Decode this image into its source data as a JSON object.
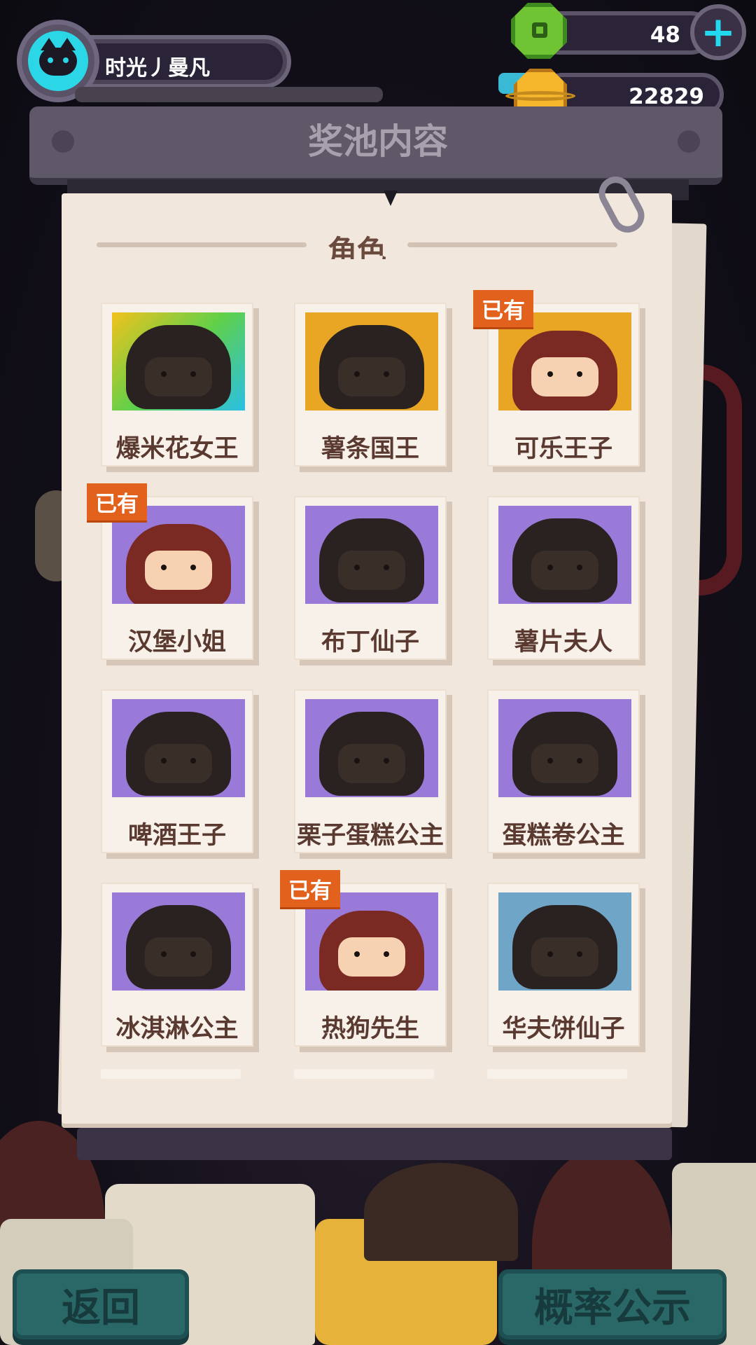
{
  "player": {
    "name": "时光丿曼凡"
  },
  "currencies": {
    "gems": {
      "value": "48"
    },
    "coins": {
      "value": "22829"
    }
  },
  "panel": {
    "title": "奖池内容",
    "section_title": "角色"
  },
  "owned_label": "已有",
  "characters": [
    {
      "name": "爆米花女王",
      "owned": false
    },
    {
      "name": "薯条国王",
      "owned": false
    },
    {
      "name": "可乐王子",
      "owned": true
    },
    {
      "name": "汉堡小姐",
      "owned": true
    },
    {
      "name": "布丁仙子",
      "owned": false
    },
    {
      "name": "薯片夫人",
      "owned": false
    },
    {
      "name": "啤酒王子",
      "owned": false
    },
    {
      "name": "栗子蛋糕公主",
      "owned": false
    },
    {
      "name": "蛋糕卷公主",
      "owned": false
    },
    {
      "name": "冰淇淋公主",
      "owned": false
    },
    {
      "name": "热狗先生",
      "owned": true
    },
    {
      "name": "华夫饼仙子",
      "owned": false
    }
  ],
  "buttons": {
    "back": "返回",
    "probability": "概率公示"
  },
  "colors": {
    "owned_badge": "#e2611c",
    "accent_cyan": "#22d9f0",
    "button_teal": "#2a6868"
  }
}
